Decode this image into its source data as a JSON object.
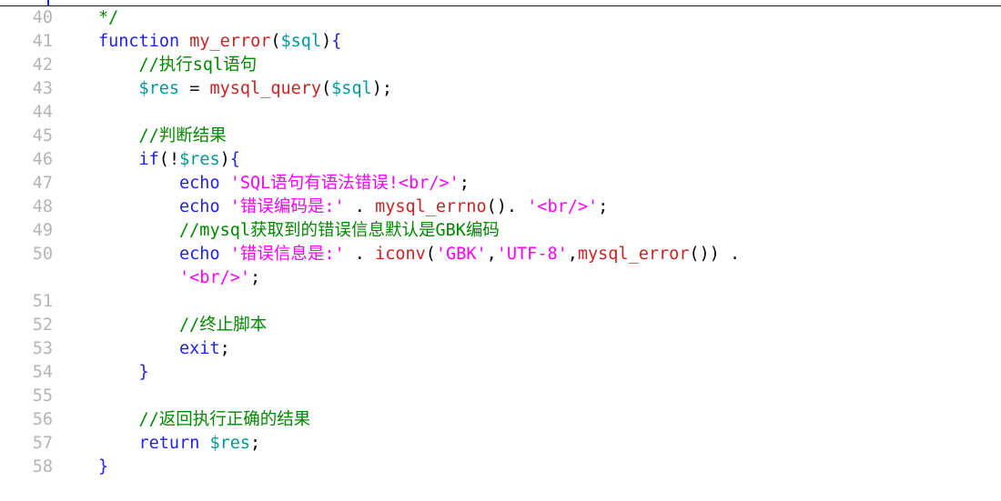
{
  "editor": {
    "title": "PHP source code editor",
    "language": "PHP",
    "gutter_color": "#b4b4b4",
    "background_color": "#ffffff",
    "caret_column_marker": true,
    "theme_colors": {
      "keyword": "#2222ee",
      "function": "#cc2222",
      "variable": "#009999",
      "string": "#ff00ff",
      "comment": "#008800",
      "punctuation": "#8b1a1a",
      "brace": "#2222ee",
      "line_number": "#b4b4b4",
      "background": "#ffffff"
    }
  },
  "lines": [
    {
      "number": "40",
      "indent": 0,
      "tokens": [
        {
          "t": "*/",
          "c": "cmt"
        }
      ]
    },
    {
      "number": "41",
      "indent": 0,
      "tokens": [
        {
          "t": "function",
          "c": "kw"
        },
        {
          "t": " ",
          "c": "plain"
        },
        {
          "t": "my_error",
          "c": "fn"
        },
        {
          "t": "(",
          "c": "pun"
        },
        {
          "t": "$sql",
          "c": "var"
        },
        {
          "t": ")",
          "c": "pun"
        },
        {
          "t": "{",
          "c": "brc"
        }
      ]
    },
    {
      "number": "42",
      "indent": 4,
      "tokens": [
        {
          "t": "//执行sql语句",
          "c": "cmt"
        }
      ]
    },
    {
      "number": "43",
      "indent": 4,
      "tokens": [
        {
          "t": "$res",
          "c": "var"
        },
        {
          "t": " = ",
          "c": "plain"
        },
        {
          "t": "mysql_query",
          "c": "fn"
        },
        {
          "t": "(",
          "c": "pun"
        },
        {
          "t": "$sql",
          "c": "var"
        },
        {
          "t": ")",
          "c": "pun"
        },
        {
          "t": ";",
          "c": "pun"
        }
      ]
    },
    {
      "number": "44",
      "indent": 0,
      "tokens": []
    },
    {
      "number": "45",
      "indent": 4,
      "tokens": [
        {
          "t": "//判断结果",
          "c": "cmt"
        }
      ]
    },
    {
      "number": "46",
      "indent": 4,
      "tokens": [
        {
          "t": "if",
          "c": "kw"
        },
        {
          "t": "(",
          "c": "pun"
        },
        {
          "t": "!",
          "c": "pun"
        },
        {
          "t": "$res",
          "c": "var"
        },
        {
          "t": ")",
          "c": "pun"
        },
        {
          "t": "{",
          "c": "brc"
        }
      ]
    },
    {
      "number": "47",
      "indent": 8,
      "tokens": [
        {
          "t": "echo",
          "c": "kw"
        },
        {
          "t": " ",
          "c": "plain"
        },
        {
          "t": "'SQL语句有语法错误!<br/>'",
          "c": "str"
        },
        {
          "t": ";",
          "c": "pun"
        }
      ]
    },
    {
      "number": "48",
      "indent": 8,
      "tokens": [
        {
          "t": "echo",
          "c": "kw"
        },
        {
          "t": " ",
          "c": "plain"
        },
        {
          "t": "'错误编码是:'",
          "c": "str"
        },
        {
          "t": " ",
          "c": "plain"
        },
        {
          "t": ".",
          "c": "pun"
        },
        {
          "t": " ",
          "c": "plain"
        },
        {
          "t": "mysql_errno",
          "c": "fn"
        },
        {
          "t": "()",
          "c": "pun"
        },
        {
          "t": ".",
          "c": "pun"
        },
        {
          "t": " ",
          "c": "plain"
        },
        {
          "t": "'<br/>'",
          "c": "str"
        },
        {
          "t": ";",
          "c": "pun"
        }
      ]
    },
    {
      "number": "49",
      "indent": 8,
      "tokens": [
        {
          "t": "//mysql获取到的错误信息默认是GBK编码",
          "c": "cmt"
        }
      ]
    },
    {
      "number": "50",
      "indent": 8,
      "tokens": [
        {
          "t": "echo",
          "c": "kw"
        },
        {
          "t": " ",
          "c": "plain"
        },
        {
          "t": "'错误信息是:'",
          "c": "str"
        },
        {
          "t": " ",
          "c": "plain"
        },
        {
          "t": ".",
          "c": "pun"
        },
        {
          "t": " ",
          "c": "plain"
        },
        {
          "t": "iconv",
          "c": "fn"
        },
        {
          "t": "(",
          "c": "pun"
        },
        {
          "t": "'GBK'",
          "c": "str"
        },
        {
          "t": ",",
          "c": "pun"
        },
        {
          "t": "'UTF-8'",
          "c": "str"
        },
        {
          "t": ",",
          "c": "pun"
        },
        {
          "t": "mysql_error",
          "c": "fn"
        },
        {
          "t": "())",
          "c": "pun"
        },
        {
          "t": " ",
          "c": "plain"
        },
        {
          "t": ".",
          "c": "pun"
        }
      ]
    },
    {
      "number": "",
      "indent": 8,
      "wrapped": true,
      "tokens": [
        {
          "t": "'<br/>'",
          "c": "str"
        },
        {
          "t": ";",
          "c": "pun"
        }
      ]
    },
    {
      "number": "51",
      "indent": 0,
      "tokens": []
    },
    {
      "number": "52",
      "indent": 8,
      "tokens": [
        {
          "t": "//终止脚本",
          "c": "cmt"
        }
      ]
    },
    {
      "number": "53",
      "indent": 8,
      "tokens": [
        {
          "t": "exit",
          "c": "kw"
        },
        {
          "t": ";",
          "c": "pun"
        }
      ]
    },
    {
      "number": "54",
      "indent": 4,
      "tokens": [
        {
          "t": "}",
          "c": "brc"
        }
      ]
    },
    {
      "number": "55",
      "indent": 0,
      "tokens": []
    },
    {
      "number": "56",
      "indent": 4,
      "tokens": [
        {
          "t": "//返回执行正确的结果",
          "c": "cmt"
        }
      ]
    },
    {
      "number": "57",
      "indent": 4,
      "tokens": [
        {
          "t": "return",
          "c": "kw"
        },
        {
          "t": " ",
          "c": "plain"
        },
        {
          "t": "$res",
          "c": "var"
        },
        {
          "t": ";",
          "c": "pun"
        }
      ]
    },
    {
      "number": "58",
      "indent": 0,
      "tokens": [
        {
          "t": "}",
          "c": "brc"
        }
      ]
    }
  ]
}
